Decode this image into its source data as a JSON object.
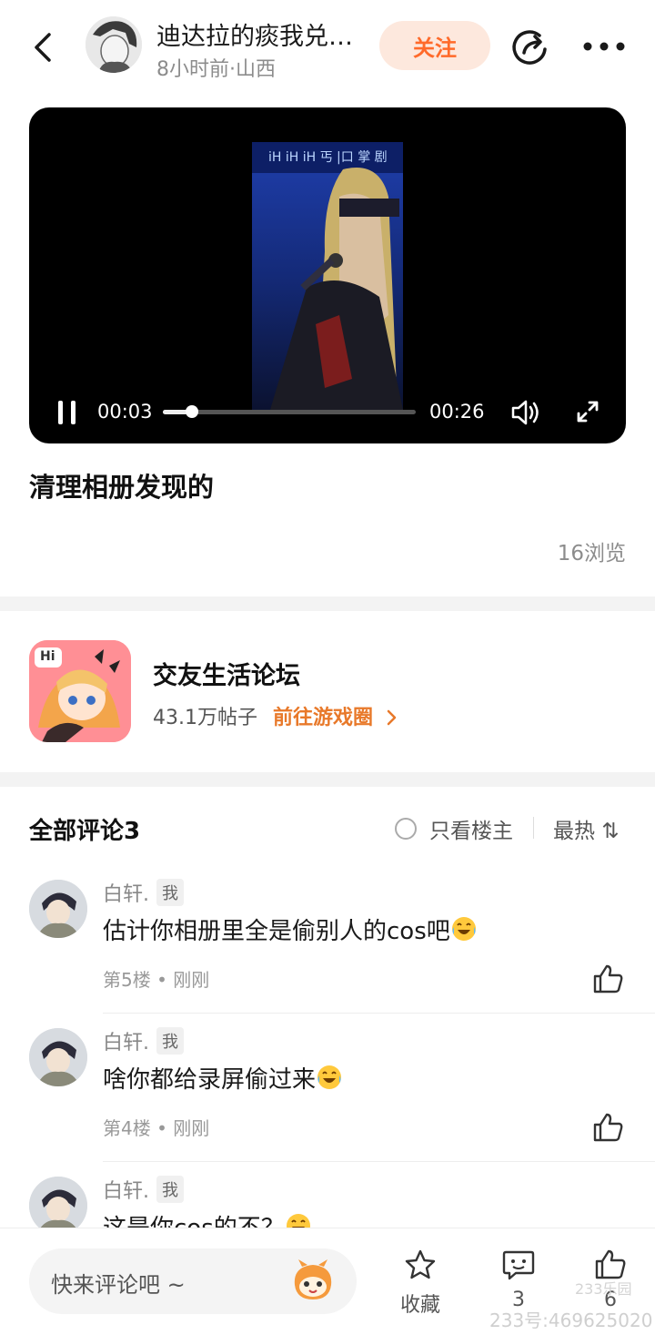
{
  "header": {
    "title": "迪达拉的痰我兑…",
    "subtitle": "8小时前·山西",
    "follow_label": "关注"
  },
  "video": {
    "current_time": "00:03",
    "duration": "00:26",
    "progress": 0.115,
    "overlay_text": "iH iH iH 丐 |口 掌 剧"
  },
  "post": {
    "title": "清理相册发现的",
    "views": "16浏览"
  },
  "community": {
    "name": "交友生活论坛",
    "count": "43.1万帖子",
    "link_label": "前往游戏圈",
    "icon_badge": "Hi"
  },
  "comments_section": {
    "title": "全部评论3",
    "only_op_label": "只看楼主",
    "sort_label": "最热 ⇅"
  },
  "comments": [
    {
      "user": "白轩.",
      "badge": "我",
      "text": "估计你相册里全是偷别人的cos吧",
      "meta": "第5楼 • 刚刚"
    },
    {
      "user": "白轩.",
      "badge": "我",
      "text": "啥你都给录屏偷过来",
      "meta": "第4楼 • 刚刚"
    },
    {
      "user": "白轩.",
      "badge": "我",
      "text": "这是你cos的不？",
      "meta": ""
    }
  ],
  "bottom_bar": {
    "input_placeholder": "快来评论吧 ~",
    "favorite_label": "收藏",
    "comment_count": "3",
    "like_count": "6"
  },
  "watermark": {
    "text": "233号:469625020",
    "logo_text": "233乐园"
  },
  "colors": {
    "accent": "#ff6a2a",
    "follow_bg": "#fde8dd",
    "link": "#e8792a"
  }
}
